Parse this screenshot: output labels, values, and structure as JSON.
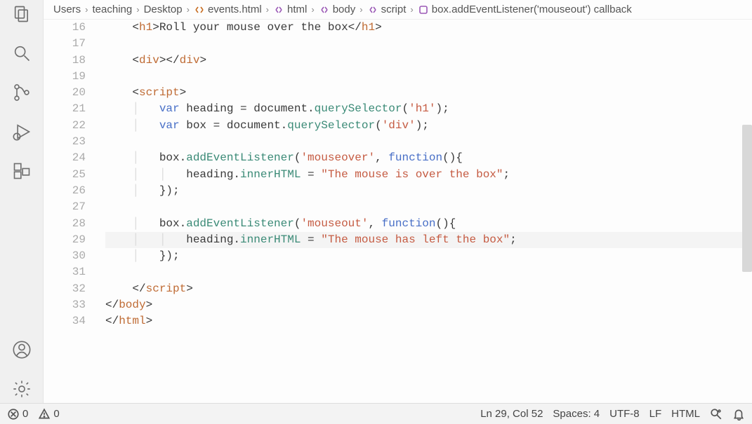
{
  "breadcrumbs": {
    "c0": "Users",
    "c1": "teaching",
    "c2": "Desktop",
    "c3": "events.html",
    "c4": "html",
    "c5": "body",
    "c6": "script",
    "c7": "box.addEventListener('mouseout') callback"
  },
  "line_numbers": [
    "16",
    "17",
    "18",
    "19",
    "20",
    "21",
    "22",
    "23",
    "24",
    "25",
    "26",
    "27",
    "28",
    "29",
    "30",
    "31",
    "32",
    "33",
    "34"
  ],
  "code": {
    "l16": {
      "r0": "<",
      "r1": "h1",
      "r2": ">Roll your mouse over the box</",
      "r3": "h1",
      "r4": ">"
    },
    "l18": {
      "r0": "<",
      "r1": "div",
      "r2": "></",
      "r3": "div",
      "r4": ">"
    },
    "l20": {
      "r0": "<",
      "r1": "script",
      "r2": ">"
    },
    "l21": {
      "r0": "var",
      "r1": " heading = document.",
      "r2": "querySelector",
      "r3": "(",
      "r4": "'h1'",
      "r5": ");"
    },
    "l22": {
      "r0": "var",
      "r1": " box = document.",
      "r2": "querySelector",
      "r3": "(",
      "r4": "'div'",
      "r5": ");"
    },
    "l24": {
      "r0": "box.",
      "r1": "addEventListener",
      "r2": "(",
      "r3": "'mouseover'",
      "r4": ", ",
      "r5": "function",
      "r6": "(){"
    },
    "l25": {
      "r0": "heading.",
      "r1": "innerHTML",
      "r2": " = ",
      "r3": "\"The mouse is over the box\"",
      "r4": ";"
    },
    "l26": {
      "r0": "});"
    },
    "l28": {
      "r0": "box.",
      "r1": "addEventListener",
      "r2": "(",
      "r3": "'mouseout'",
      "r4": ", ",
      "r5": "function",
      "r6": "(){"
    },
    "l29": {
      "r0": "heading.",
      "r1": "innerHTML",
      "r2": " = ",
      "r3": "\"The mouse has left the box\"",
      "r4": ";"
    },
    "l30": {
      "r0": "});"
    },
    "l32": {
      "r0": "</",
      "r1": "script",
      "r2": ">"
    },
    "l33": {
      "r0": "</",
      "r1": "body",
      "r2": ">"
    },
    "l34": {
      "r0": "</",
      "r1": "html",
      "r2": ">"
    }
  },
  "status": {
    "errors": "0",
    "warnings": "0",
    "cursor": "Ln 29, Col 52",
    "spaces": "Spaces: 4",
    "encoding": "UTF-8",
    "eol": "LF",
    "lang": "HTML"
  }
}
